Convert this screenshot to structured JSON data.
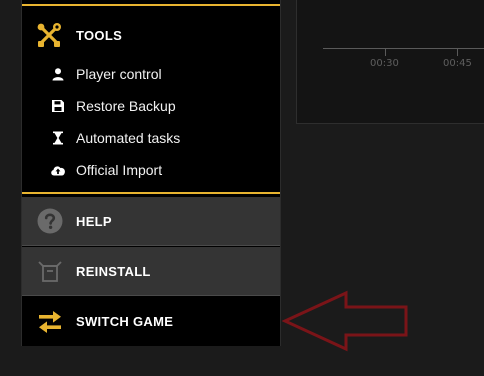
{
  "sidebar": {
    "tools": {
      "label": "TOOLS",
      "icon": "tools-icon",
      "accent_color": "#e8b430",
      "items": [
        {
          "label": "Player control",
          "icon": "user-icon"
        },
        {
          "label": "Restore Backup",
          "icon": "save-icon"
        },
        {
          "label": "Automated tasks",
          "icon": "hourglass-icon"
        },
        {
          "label": "Official Import",
          "icon": "cloud-upload-icon"
        }
      ]
    },
    "help": {
      "label": "HELP",
      "icon": "question-circle-icon"
    },
    "reinstall": {
      "label": "REINSTALL",
      "icon": "box-icon"
    },
    "switch_game": {
      "label": "SWITCH GAME",
      "icon": "swap-arrows-icon"
    }
  },
  "timeline": {
    "ticks": [
      "00:30",
      "00:45"
    ]
  },
  "annotation": {
    "icon": "red-arrow-pointer",
    "color": "#7a1418"
  }
}
